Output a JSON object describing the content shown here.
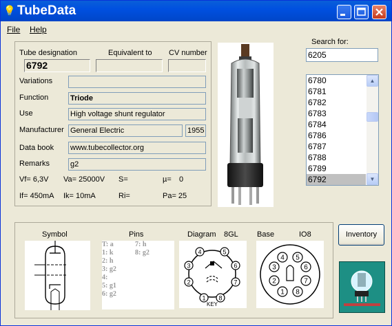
{
  "window": {
    "title": "TubeData"
  },
  "menu": {
    "file": "File",
    "help": "Help"
  },
  "labels": {
    "tube_designation": "Tube designation",
    "equivalent_to": "Equivalent to",
    "cv_number": "CV number",
    "variations": "Variations",
    "function": "Function",
    "use": "Use",
    "manufacturer": "Manufacturer",
    "data_book": "Data book",
    "remarks": "Remarks",
    "search_for": "Search for:"
  },
  "tube": {
    "designation": "6792",
    "equivalent": "",
    "cv_number": "",
    "variations": "",
    "function": "Triode",
    "use": "High voltage shunt regulator",
    "manufacturer": "General Electric",
    "year": "1955",
    "data_book": "www.tubecollector.org",
    "remarks": "g2"
  },
  "specs": {
    "vf": "Vf= 6,3V",
    "va": "Va= 25000V",
    "s": "S=",
    "mu": "µ=",
    "mu_value": "0",
    "if": "If= 450mA",
    "ik": "Ik= 10mA",
    "ri": "Ri=",
    "pa": "Pa= 25"
  },
  "search": {
    "value": "6205"
  },
  "list": {
    "items": [
      "6780",
      "6781",
      "6782",
      "6783",
      "6784",
      "6786",
      "6787",
      "6788",
      "6789",
      "6792"
    ],
    "selected": "6792"
  },
  "bottom": {
    "symbol": "Symbol",
    "pins": "Pins",
    "diagram": "Diagram",
    "diagram_code": "8GL",
    "base": "Base",
    "base_code": "IO8",
    "pins_col1": [
      "T: a",
      "1: k",
      "2: h",
      "3: g2",
      "4:",
      "5: g1",
      "6: g2"
    ],
    "pins_col2": [
      "7: h",
      "8: g2"
    ],
    "diagram_pins": [
      "1",
      "2",
      "3",
      "4",
      "5",
      "6",
      "7",
      "8"
    ],
    "diagram_key": "KEY"
  },
  "buttons": {
    "inventory": "Inventory"
  },
  "colors": {
    "titlebar": "#0050e0",
    "selected": "#c0c0c0"
  }
}
